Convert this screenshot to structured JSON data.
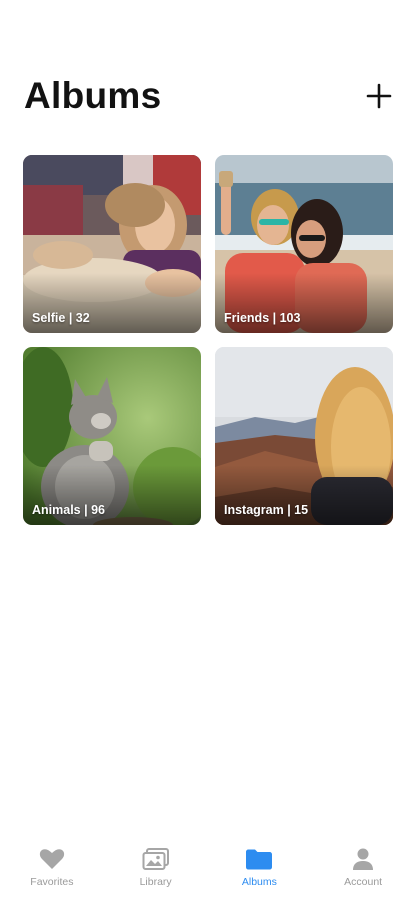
{
  "header": {
    "title": "Albums",
    "add_icon": "plus-icon"
  },
  "albums": [
    {
      "label": "Selfie | 32",
      "name": "Selfie",
      "count": 32,
      "thumbnail": "woman-lying-selfie-photo"
    },
    {
      "label": "Friends | 103",
      "name": "Friends",
      "count": 103,
      "thumbnail": "friends-beach-selfie-photo"
    },
    {
      "label": "Animals | 96",
      "name": "Animals",
      "count": 96,
      "thumbnail": "kitten-photo"
    },
    {
      "label": "Instagram | 15",
      "name": "Instagram",
      "count": 15,
      "thumbnail": "woman-canyon-view-photo"
    }
  ],
  "tabs": [
    {
      "label": "Favorites",
      "icon": "heart-icon",
      "active": false
    },
    {
      "label": "Library",
      "icon": "photo-stack-icon",
      "active": false
    },
    {
      "label": "Albums",
      "icon": "folder-icon",
      "active": true
    },
    {
      "label": "Account",
      "icon": "person-icon",
      "active": false
    }
  ],
  "colors": {
    "accent": "#2d8cf0",
    "inactive": "#9a9a9a",
    "title": "#121212"
  }
}
